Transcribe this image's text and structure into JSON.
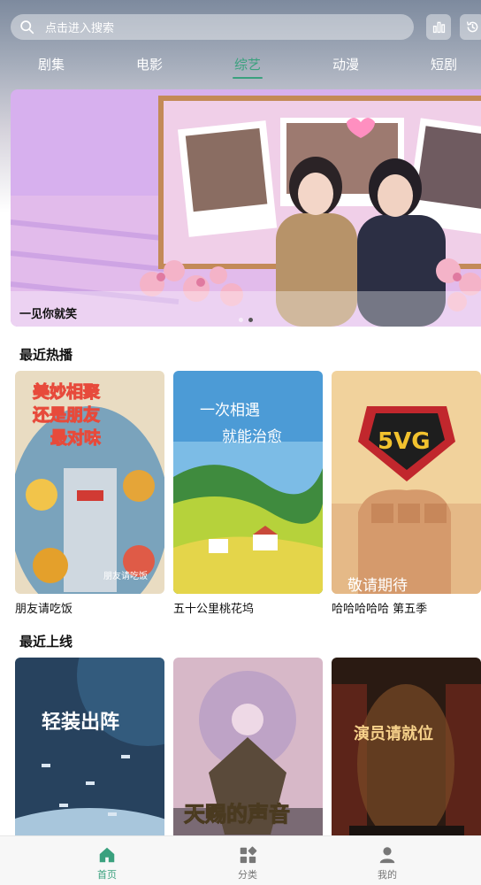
{
  "search": {
    "placeholder": "点击进入搜索"
  },
  "tabs": [
    {
      "label": "剧集",
      "active": false
    },
    {
      "label": "电影",
      "active": false
    },
    {
      "label": "综艺",
      "active": true
    },
    {
      "label": "动漫",
      "active": false
    },
    {
      "label": "短剧",
      "active": false
    }
  ],
  "banner": {
    "caption": "一见你就笑",
    "slide_count": 2,
    "active_slide": 2
  },
  "sections": [
    {
      "title": "最近热播",
      "items": [
        {
          "title": "朋友请吃饭",
          "poster_text": "美妙相聚 还是朋友 最对味"
        },
        {
          "title": "五十公里桃花坞",
          "poster_text": "一次相遇 就能治愈"
        },
        {
          "title": "哈哈哈哈哈  第五季",
          "poster_text": "敬请期待"
        }
      ]
    },
    {
      "title": "最近上线",
      "items": [
        {
          "title": "",
          "poster_text": "轻装出阵"
        },
        {
          "title": "",
          "poster_text": "天赐的声音"
        },
        {
          "title": "",
          "poster_text": "演员请就位"
        }
      ]
    }
  ],
  "bottom_nav": [
    {
      "label": "首页",
      "icon": "home-icon",
      "active": true
    },
    {
      "label": "分类",
      "icon": "grid-icon",
      "active": false
    },
    {
      "label": "我的",
      "icon": "user-icon",
      "active": false
    }
  ],
  "colors": {
    "accent": "#3aa17e",
    "nav_inactive": "#777777"
  }
}
